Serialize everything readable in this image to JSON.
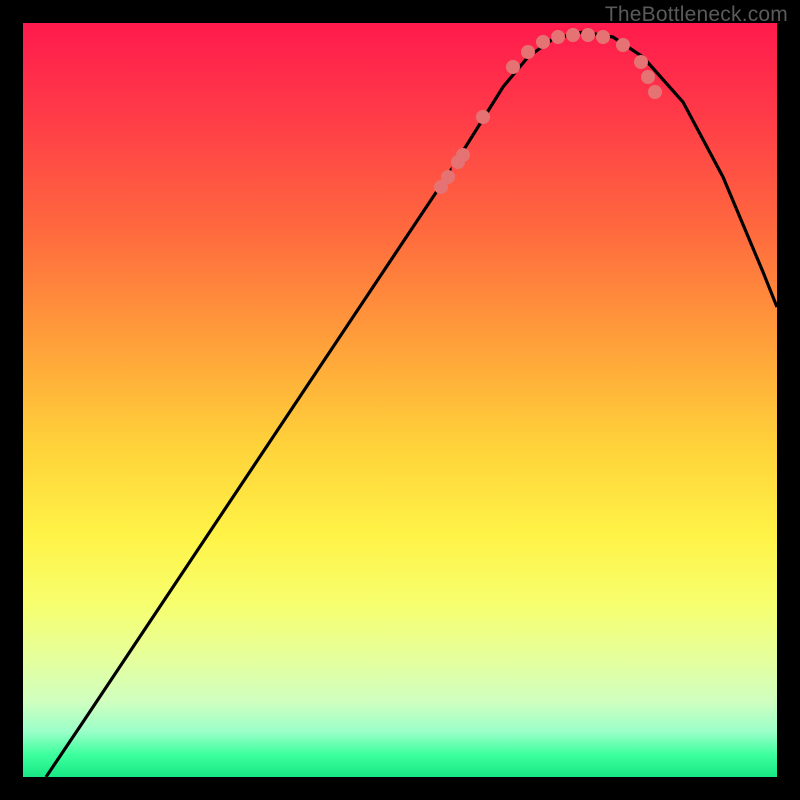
{
  "watermark": "TheBottleneck.com",
  "colors": {
    "bg": "#000000",
    "curve": "#000000",
    "dot": "#e57373",
    "needle": "#ff4d4d"
  },
  "chart_data": {
    "type": "line",
    "title": "",
    "xlabel": "",
    "ylabel": "",
    "xlim": [
      0,
      754
    ],
    "ylim": [
      0,
      754
    ],
    "series": [
      {
        "name": "bottleneck-curve",
        "x": [
          23,
          60,
          100,
          150,
          200,
          250,
          300,
          350,
          400,
          430,
          455,
          480,
          505,
          530,
          560,
          590,
          620,
          660,
          700,
          740,
          754
        ],
        "y": [
          0,
          55,
          115,
          190,
          265,
          340,
          415,
          490,
          565,
          610,
          650,
          690,
          720,
          738,
          745,
          740,
          720,
          675,
          600,
          505,
          470
        ]
      }
    ],
    "markers": {
      "name": "highlight-dots",
      "x": [
        418,
        425,
        435,
        440,
        460,
        490,
        505,
        520,
        535,
        550,
        565,
        580,
        600,
        618,
        625,
        632
      ],
      "y": [
        590,
        600,
        615,
        622,
        660,
        710,
        725,
        735,
        740,
        742,
        742,
        740,
        732,
        715,
        700,
        685
      ]
    },
    "needle_tick": {
      "x": 430,
      "y_top": 600,
      "y_bottom": 630
    }
  }
}
